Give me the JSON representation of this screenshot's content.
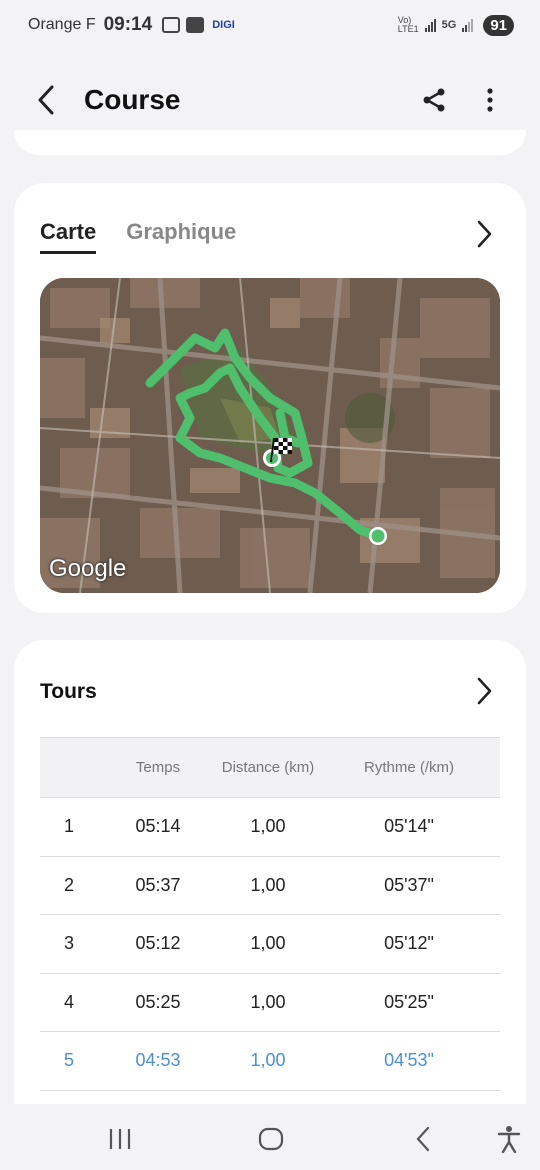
{
  "status_bar": {
    "carrier": "Orange F",
    "time": "09:14",
    "operator_tag": "DIGI",
    "net_label_1": "Vo)",
    "net_label_2": "LTE1",
    "net_type": "5G",
    "battery": "91"
  },
  "header": {
    "title": "Course",
    "back_icon": "chevron-left-icon",
    "share_icon": "share-icon",
    "more_icon": "more-vertical-icon"
  },
  "map_card": {
    "tabs": [
      {
        "label": "Carte",
        "active": true
      },
      {
        "label": "Graphique",
        "active": false
      }
    ],
    "map_attribution": "Google",
    "route_color": "#4fbf6e"
  },
  "laps": {
    "title": "Tours",
    "columns": [
      "",
      "Temps",
      "Distance (km)",
      "Rythme (/km)"
    ],
    "rows": [
      {
        "lap": "1",
        "time": "05:14",
        "distance": "1,00",
        "pace": "05'14\""
      },
      {
        "lap": "2",
        "time": "05:37",
        "distance": "1,00",
        "pace": "05'37\""
      },
      {
        "lap": "3",
        "time": "05:12",
        "distance": "1,00",
        "pace": "05'12\""
      },
      {
        "lap": "4",
        "time": "05:25",
        "distance": "1,00",
        "pace": "05'25\""
      },
      {
        "lap": "5",
        "time": "04:53",
        "distance": "1,00",
        "pace": "04'53\"",
        "highlight": true
      }
    ],
    "highlight_color": "#4a8fd8"
  },
  "nav": {
    "recents_icon": "recents-icon",
    "home_icon": "home-icon",
    "back_icon": "back-icon",
    "accessibility_icon": "accessibility-icon"
  }
}
